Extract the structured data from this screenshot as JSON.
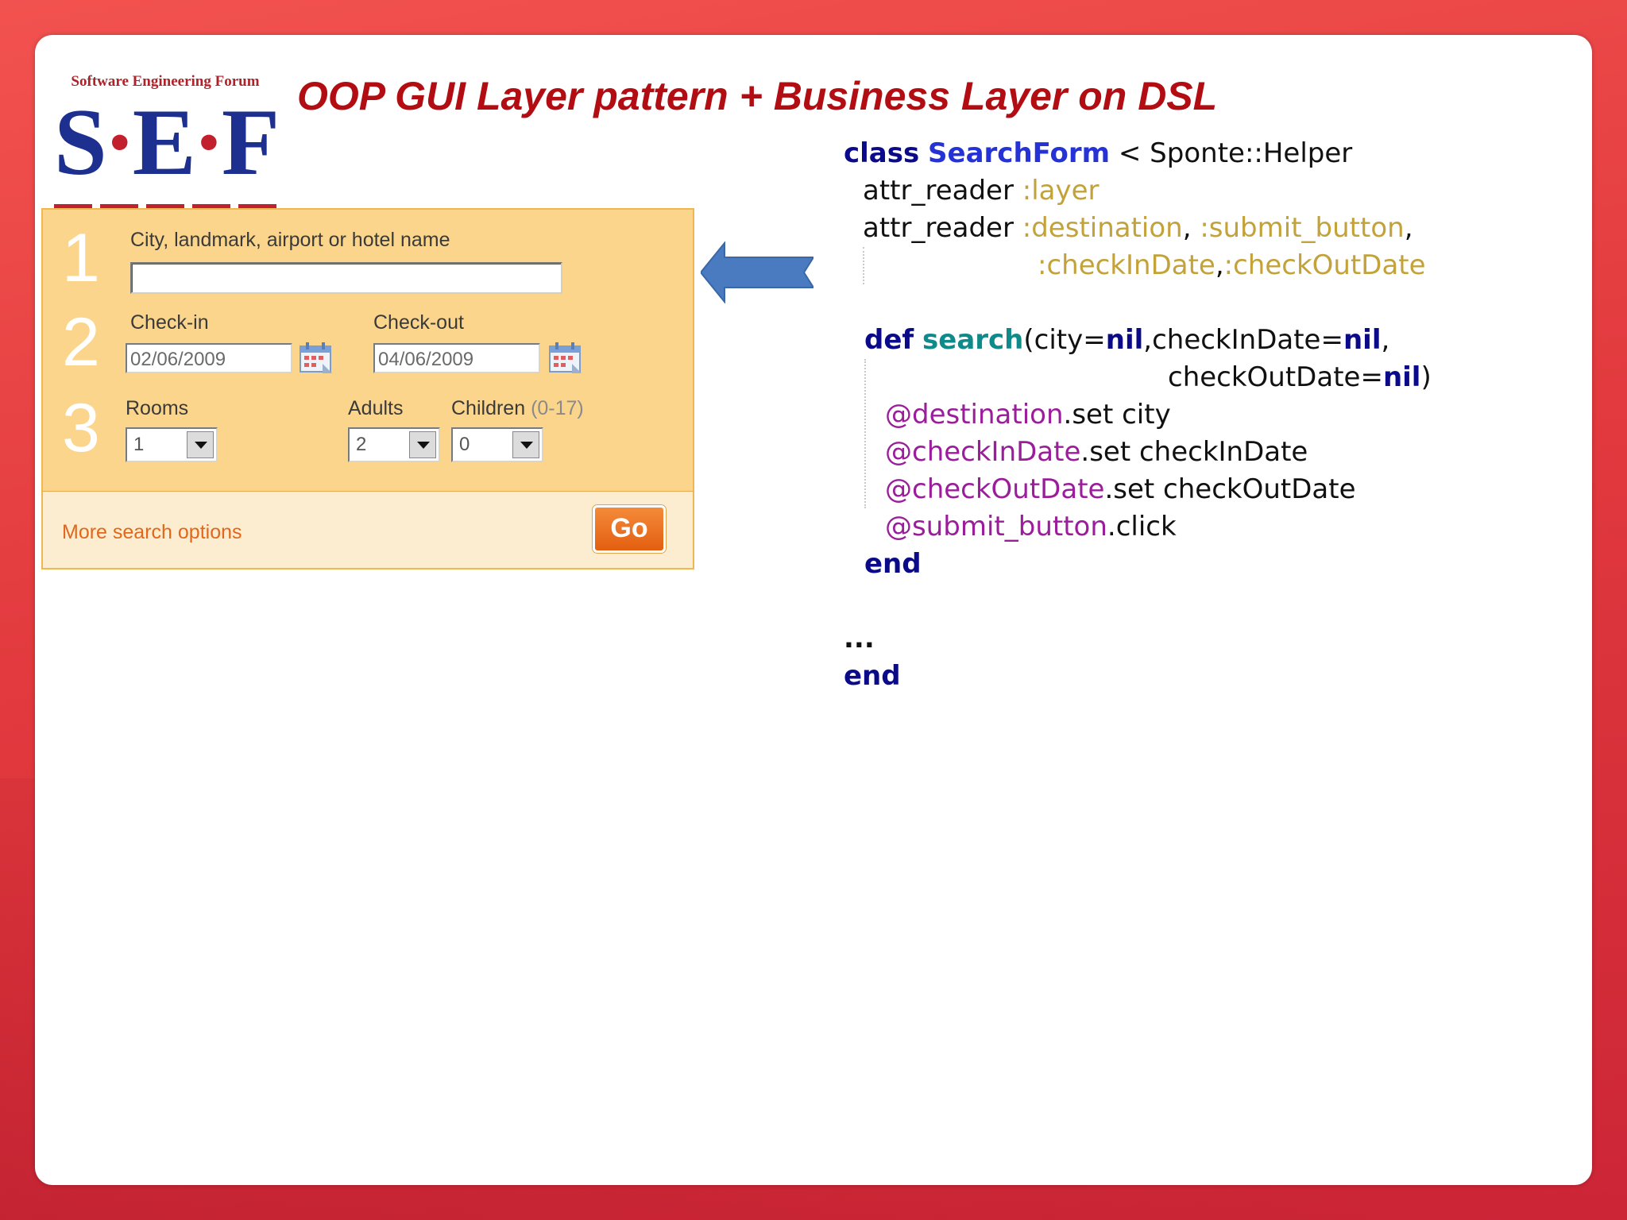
{
  "slide": {
    "title": "OOP GUI Layer pattern + Business Layer on DSL",
    "colors": {
      "title": "#b10d12",
      "frame": "#e23a3e"
    }
  },
  "logo": {
    "text": "Software Engineering Forum",
    "mark_letters": [
      "S",
      "E",
      "F"
    ]
  },
  "search_form": {
    "step1": {
      "number": "1",
      "label": "City, landmark, airport or hotel name",
      "value": ""
    },
    "step2": {
      "number": "2",
      "checkin_label": "Check-in",
      "checkin_value": "02/06/2009",
      "checkout_label": "Check-out",
      "checkout_value": "04/06/2009",
      "calendar_icon": "calendar-icon"
    },
    "step3": {
      "number": "3",
      "rooms_label": "Rooms",
      "rooms_value": "1",
      "adults_label": "Adults",
      "adults_value": "2",
      "children_label": "Children",
      "children_range": "(0-17)",
      "children_value": "0"
    },
    "more_options_label": "More search options",
    "go_label": "Go",
    "colors": {
      "panel": "#fbd58c",
      "footer": "#fdedd0",
      "go": "#e35e10",
      "link": "#e0671c"
    }
  },
  "arrow": {
    "icon": "left-arrow-icon",
    "color": "#4a7bc0"
  },
  "code": {
    "l1_kw": "class",
    "l1_name": "SearchForm",
    "l1_rest": " < Sponte::Helper",
    "l2_a": "attr_reader ",
    "l2_b": ":layer",
    "l3_a": "attr_reader ",
    "l3_b": ":destination",
    "l3_c": ", ",
    "l3_d": ":submit_button",
    "l3_e": ",",
    "l4_a": ":checkInDate",
    "l4_b": ",",
    "l4_c": ":checkOutDate",
    "l5_kw": "def",
    "l5_name": "search",
    "l5_p1": "(city=",
    "l5_nil1": "nil",
    "l5_p2": ",checkInDate=",
    "l5_nil2": "nil",
    "l5_p3": ",",
    "l6_a": "checkOutDate=",
    "l6_nil": "nil",
    "l6_b": ")",
    "l7_ivar": "@destination",
    "l7_rest": ".set city",
    "l8_ivar": "@checkInDate",
    "l8_rest": ".set checkInDate",
    "l9_ivar": "@checkOutDate",
    "l9_rest": ".set checkOutDate",
    "l10_ivar": "@submit_button",
    "l10_rest": ".click",
    "l11_kw": "end",
    "l12": "...",
    "l13_kw": "end"
  }
}
